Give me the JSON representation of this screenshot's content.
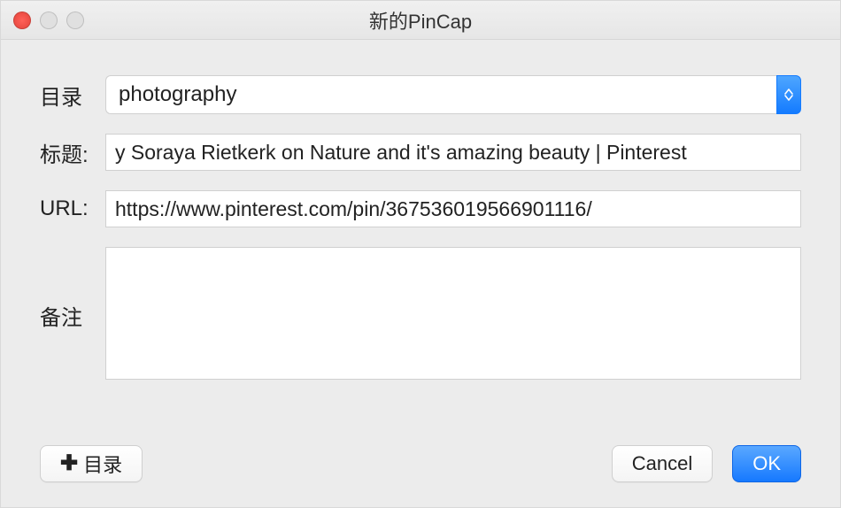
{
  "window": {
    "title": "新的PinCap"
  },
  "labels": {
    "directory": "目录",
    "title": "标题:",
    "url": "URL:",
    "notes": "备注"
  },
  "form": {
    "directory_value": "photography",
    "title_value": "y Soraya Rietkerk on Nature and it's amazing beauty | Pinterest",
    "url_value": "https://www.pinterest.com/pin/367536019566901116/",
    "notes_value": ""
  },
  "buttons": {
    "add_directory": "目录",
    "cancel": "Cancel",
    "ok": "OK"
  }
}
